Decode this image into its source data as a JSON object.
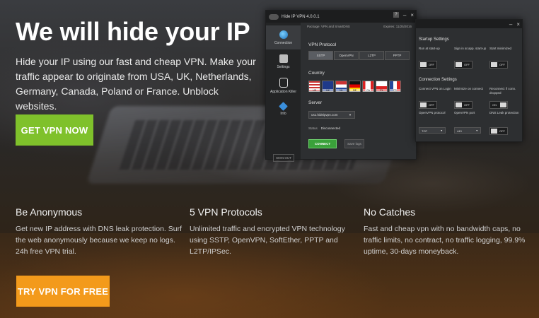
{
  "hero": {
    "title": "We will hide your IP",
    "description": "Hide your IP using our fast and cheap VPN. Make your traffic appear to originate from USA, UK, Netherlands, Germany, Canada, Poland or France. Unblock websites.",
    "cta_label": "GET VPN NOW"
  },
  "features": [
    {
      "title": "Be Anonymous",
      "text": "Get new IP address with DNS leak protection. Surf the web anonymously because we keep no logs. 24h free VPN trial."
    },
    {
      "title": "5 VPN Protocols",
      "text": "Unlimited traffic and encrypted VPN technology using SSTP, OpenVPN, SoftEther, PPTP and L2TP/IPSec."
    },
    {
      "title": "No Catches",
      "text": "Fast and cheap vpn with no bandwidth caps, no traffic limits, no contract, no traffic logging, 99.9% uptime, 30-days moneyback."
    }
  ],
  "trial_label": "TRY VPN FOR FREE",
  "app": {
    "title": "Hide IP VPN 4.0.0.1",
    "help": "?",
    "minimize": "–",
    "close": "×",
    "package": "Package: VPN and SmartDNS",
    "expires": "Expires: 11/25/2016",
    "sidebar": [
      "Connection",
      "Settings",
      "Application Killer",
      "Info"
    ],
    "sign_out": "SIGN OUT",
    "vpn_protocol_label": "VPN Protocol",
    "protocols": [
      "SSTP",
      "OpenVPN",
      "L2TP",
      "PPTP"
    ],
    "country_label": "Country",
    "flags": [
      "US",
      "UK",
      "NL",
      "DE",
      "CA",
      "PL",
      "FR"
    ],
    "server_label": "Server",
    "server_value": "us1.hideipvpn.com",
    "status_label": "Status",
    "status_value": "Disconnected",
    "connect_label": "CONNECT",
    "save_logs_label": "Save logs"
  },
  "settings": {
    "startup_title": "Startup Settings",
    "startup": [
      {
        "label": "Run at start-up",
        "state": "OFF"
      },
      {
        "label": "Sign in at app. start-up",
        "state": "OFF"
      },
      {
        "label": "Start minimized",
        "state": "OFF"
      }
    ],
    "connection_title": "Connection Settings",
    "connection": [
      {
        "label": "Connect VPN on Login",
        "state": "OFF"
      },
      {
        "label": "Minimize on connect",
        "state": "OFF"
      },
      {
        "label": "Reconnect if conn. dropped",
        "state": "ON"
      }
    ],
    "openvpn_protocol_label": "OpenVPN protocol",
    "openvpn_protocol_value": "TCP",
    "openvpn_port_label": "OpenVPN port",
    "openvpn_port_value": "443",
    "dns_leak_label": "DNS Leak protection",
    "dns_leak_state": "OFF"
  }
}
